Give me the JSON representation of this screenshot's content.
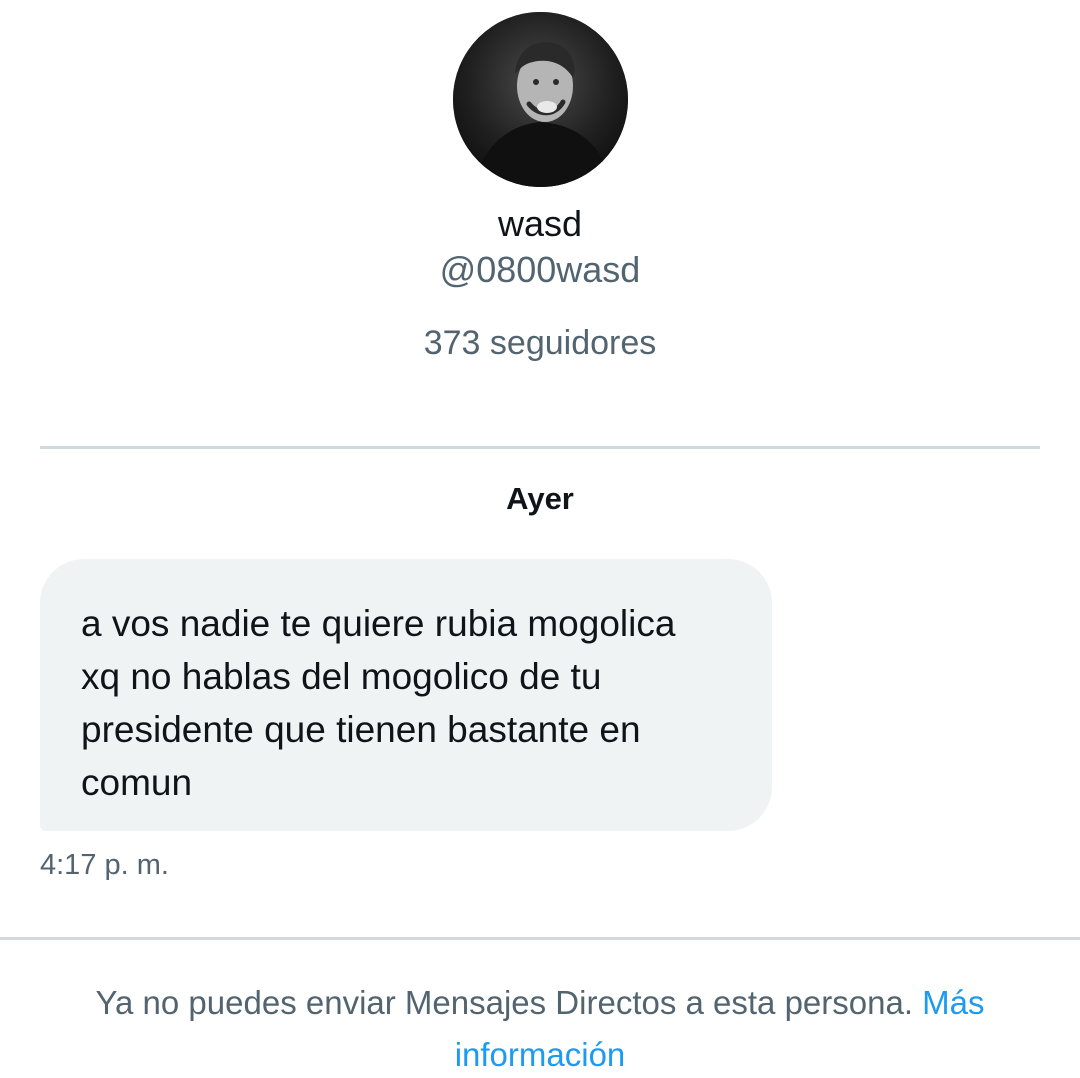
{
  "profile": {
    "name": "wasd",
    "handle": "@0800wasd",
    "followers": "373 seguidores"
  },
  "conversation": {
    "day_label": "Ayer",
    "message": {
      "lines": [
        "a vos nadie te quiere rubia mogolica",
        "xq no hablas del mogolico de tu",
        "presidente que tienen bastante en",
        "comun"
      ],
      "time": "4:17 p. m."
    }
  },
  "footer": {
    "notice_text": "Ya no puedes enviar Mensajes Directos a esta persona.",
    "link_label": "Más",
    "link_label_overflow": "información"
  },
  "colors": {
    "primary_text": "#0f1419",
    "secondary_text": "#536471",
    "link": "#1d9bf0",
    "bubble_bg": "#eff3f4",
    "divider": "#cfd9de"
  }
}
